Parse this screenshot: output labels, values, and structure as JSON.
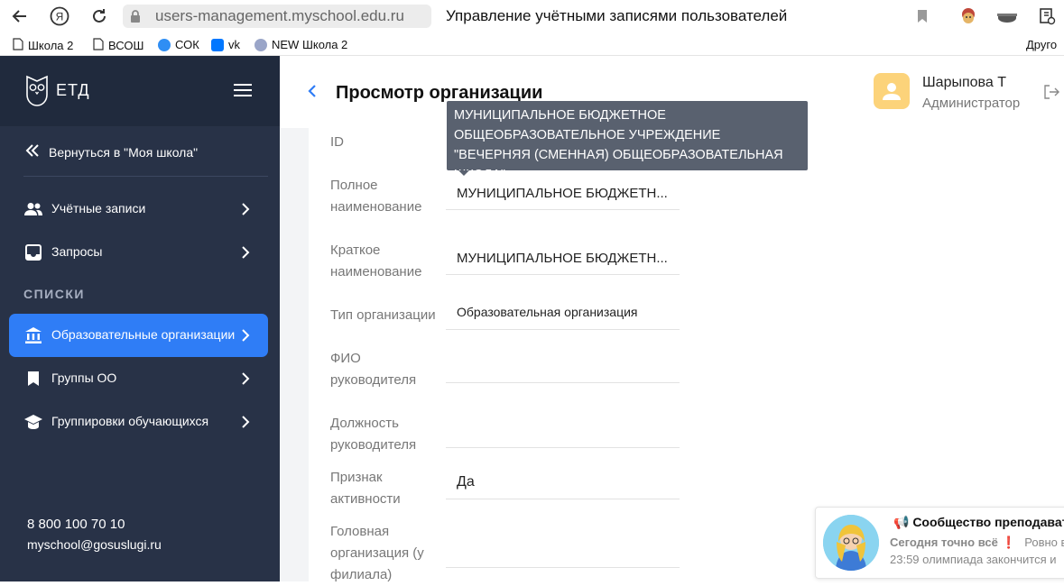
{
  "browser": {
    "url": "users-management.myschool.edu.ru",
    "title": "Управление учётными записями пользователей",
    "bookmarks": [
      "Школа 2",
      "ВСОШ",
      "СОК",
      "vk",
      "NEW Школа 2"
    ],
    "other_bookmarks": "Друго",
    "colors": {
      "sok": "#2f8ef4",
      "vk": "#0077ff",
      "new": "#9aa5c8"
    }
  },
  "sidebar": {
    "logo": "ЕТД",
    "back_link": "Вернуться в \"Моя школа\"",
    "items": [
      {
        "label": "Учётные записи",
        "icon": "users-icon"
      },
      {
        "label": "Запросы",
        "icon": "inbox-icon"
      }
    ],
    "section_title": "СПИСКИ",
    "list_items": [
      {
        "label": "Образовательные организации",
        "icon": "institution-icon",
        "active": true
      },
      {
        "label": "Группы ОО",
        "icon": "bookmark-icon"
      },
      {
        "label": "Группировки обучающихся",
        "icon": "graduation-cap-icon"
      }
    ],
    "phone": "8 800 100 70 10",
    "email": "myschool@gosuslugi.ru",
    "colors": {
      "background": "#283247",
      "header": "#202a3d",
      "active": "#2f7df6"
    }
  },
  "header": {
    "title": "Просмотр организации",
    "user_name": "Шарыпова Т",
    "user_role": "Администратор"
  },
  "tooltip": "МУНИЦИПАЛЬНОЕ БЮДЖЕТНОЕ ОБЩЕОБРАЗОВАТЕЛЬНОЕ УЧРЕЖДЕНИЕ \"ВЕЧЕРНЯЯ (СМЕННАЯ) ОБЩЕОБРАЗОВАТЕЛЬНАЯ ШКОЛА\"",
  "fields": {
    "id_label": "ID",
    "full_name_label": "Полное наименование",
    "full_name_value": "МУНИЦИПАЛЬНОЕ БЮДЖЕТН...",
    "short_name_label": "Краткое наименование",
    "short_name_value": "МУНИЦИПАЛЬНОЕ БЮДЖЕТН...",
    "org_type_label": "Тип организации",
    "org_type_value": "Образовательная организация",
    "head_name_label": "ФИО руководителя",
    "head_position_label": "Должность руководителя",
    "active_label": "Признак активности",
    "active_value": "Да",
    "parent_org_label": "Головная организация (у филиала)"
  },
  "notification": {
    "title": "📢 Сообщество преподавател",
    "line1": "Сегодня точно всё",
    "line1_tail": "Ровно в",
    "line2": "23:59 олимпиада закончится и"
  }
}
